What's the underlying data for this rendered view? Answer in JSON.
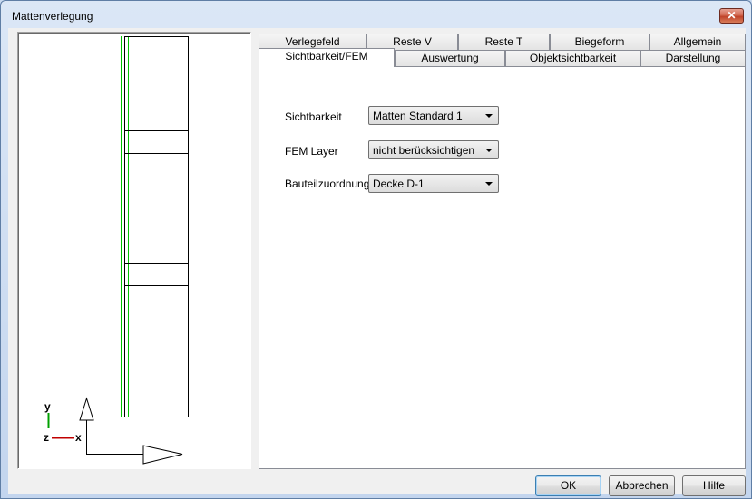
{
  "window": {
    "title": "Mattenverlegung",
    "close_label": "✕"
  },
  "preview": {
    "axis_y": "y",
    "axis_z": "z",
    "axis_x": "x",
    "line_color_green": "#00c000",
    "axis_color_x": "#c00000",
    "axis_color_y": "#00a000"
  },
  "tabs": {
    "row1": [
      "Verlegefeld",
      "Reste V",
      "Reste T",
      "Biegeform",
      "Allgemein"
    ],
    "row2": [
      "Sichtbarkeit/FEM",
      "Auswertung",
      "Objektsichtbarkeit",
      "Darstellung"
    ],
    "active": "Sichtbarkeit/FEM"
  },
  "form": {
    "sichtbarkeit_label": "Sichtbarkeit",
    "sichtbarkeit_value": "Matten Standard 1",
    "fem_layer_label": "FEM Layer",
    "fem_layer_value": "nicht berücksichtigen",
    "bauteil_label": "Bauteilzuordnung",
    "bauteil_value": "Decke D-1"
  },
  "buttons": {
    "ok": "OK",
    "cancel": "Abbrechen",
    "help": "Hilfe"
  }
}
